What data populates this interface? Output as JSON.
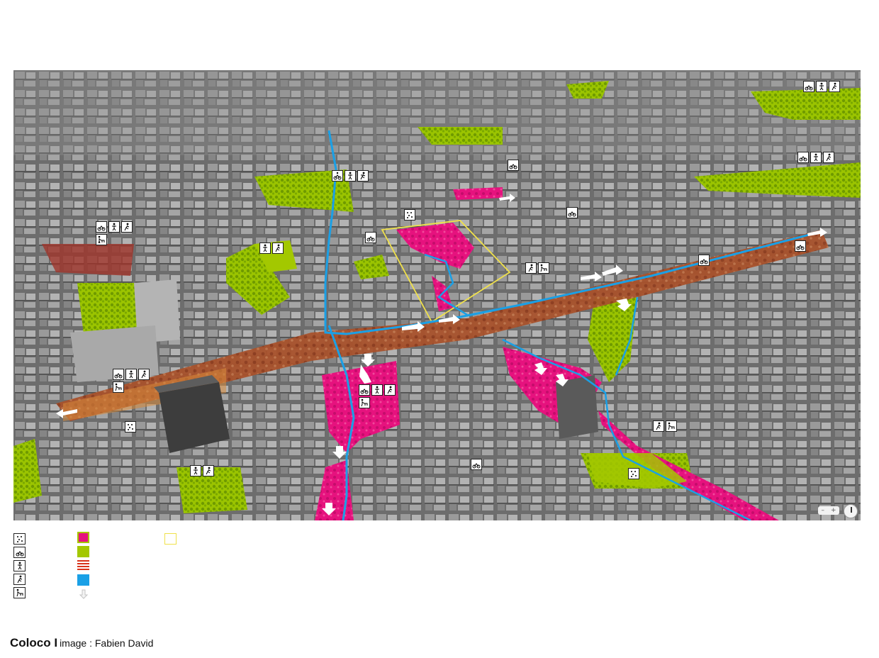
{
  "caption": {
    "brand": "Coloco I",
    "credit": "image : Fabien David"
  },
  "colors": {
    "public_space": "#e6127e",
    "vegetation": "#a3c800",
    "boulevard": "#d9331b",
    "water": "#1aa0e6",
    "project_outline": "#f0e14a"
  },
  "map": {
    "view": "aerial oblique, grayscale city with colored overlays",
    "controls": {
      "zoom_out": "–",
      "zoom_in": "+"
    }
  },
  "legend": {
    "pictograms": [
      "gardening-icon",
      "cycling-icon",
      "child-play-icon",
      "running-icon",
      "dog-walking-icon"
    ],
    "swatches": [
      "pink-public-space",
      "green-vegetation",
      "red-hatched-boulevard",
      "blue-water",
      "white-arrow-flow"
    ],
    "outline": "yellow-outline-project"
  }
}
